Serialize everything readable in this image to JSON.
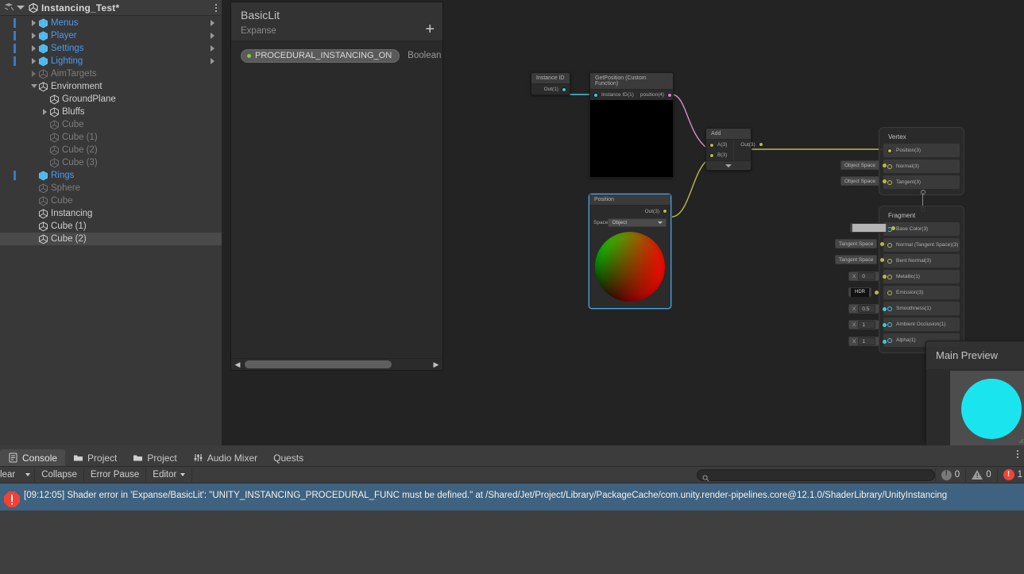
{
  "hierarchy": {
    "title": "Instancing_Test*",
    "icons": {
      "panel": "hierarchy-icon",
      "unity": "unity-logo-icon",
      "menu": "kebab-menu-icon"
    },
    "items": [
      {
        "label": "Menus",
        "indent": 1,
        "twisty": "closed",
        "style": "prefab",
        "chevron": true,
        "selbar": true
      },
      {
        "label": "Player",
        "indent": 1,
        "twisty": "closed",
        "style": "prefab",
        "chevron": true,
        "selbar": true
      },
      {
        "label": "Settings",
        "indent": 1,
        "twisty": "closed",
        "style": "prefab",
        "chevron": true,
        "selbar": true
      },
      {
        "label": "Lighting",
        "indent": 1,
        "twisty": "closed",
        "style": "prefab",
        "chevron": true,
        "selbar": true
      },
      {
        "label": "AimTargets",
        "indent": 1,
        "twisty": "closed-dim",
        "style": "dim",
        "chevron": false,
        "selbar": false
      },
      {
        "label": "Environment",
        "indent": 1,
        "twisty": "open",
        "style": "norm",
        "chevron": false,
        "selbar": false
      },
      {
        "label": "GroundPlane",
        "indent": 2,
        "twisty": "none",
        "style": "norm",
        "chevron": false,
        "selbar": false
      },
      {
        "label": "Bluffs",
        "indent": 2,
        "twisty": "closed",
        "style": "norm",
        "chevron": false,
        "selbar": false
      },
      {
        "label": "Cube",
        "indent": 2,
        "twisty": "none",
        "style": "dim",
        "chevron": false,
        "selbar": false
      },
      {
        "label": "Cube (1)",
        "indent": 2,
        "twisty": "none",
        "style": "dim",
        "chevron": false,
        "selbar": false
      },
      {
        "label": "Cube (2)",
        "indent": 2,
        "twisty": "none",
        "style": "dim",
        "chevron": false,
        "selbar": false
      },
      {
        "label": "Cube (3)",
        "indent": 2,
        "twisty": "none",
        "style": "dim",
        "chevron": false,
        "selbar": false
      },
      {
        "label": "Rings",
        "indent": 1,
        "twisty": "none",
        "style": "prefab",
        "chevron": false,
        "selbar": true
      },
      {
        "label": "Sphere",
        "indent": 1,
        "twisty": "none",
        "style": "dim",
        "chevron": false,
        "selbar": false
      },
      {
        "label": "Cube",
        "indent": 1,
        "twisty": "none",
        "style": "dim",
        "chevron": false,
        "selbar": false
      },
      {
        "label": "Instancing",
        "indent": 1,
        "twisty": "none",
        "style": "norm",
        "chevron": false,
        "selbar": false
      },
      {
        "label": "Cube (1)",
        "indent": 1,
        "twisty": "none",
        "style": "norm",
        "chevron": false,
        "selbar": false
      },
      {
        "label": "Cube (2)",
        "indent": 1,
        "twisty": "none",
        "style": "norm",
        "chevron": false,
        "selbar": false,
        "selected": true
      }
    ]
  },
  "blackboard": {
    "title": "BasicLit",
    "subtitle": "Expanse",
    "add_label": "+",
    "properties": [
      {
        "name": "PROCEDURAL_INSTANCING_ON",
        "type": "Boolean"
      }
    ]
  },
  "graph": {
    "nodes": {
      "instance_id": {
        "title": "Instance ID",
        "out_label": "Out(1)"
      },
      "get_position": {
        "title": "GetPosition (Custom Function)",
        "in_label": "Instance ID(1)",
        "out_label": "position(4)"
      },
      "add": {
        "title": "Add",
        "in_a": "A(3)",
        "in_b": "B(3)",
        "out": "Out(3)"
      },
      "position": {
        "title": "Position",
        "out_label": "Out(3)",
        "space_label": "Space",
        "space_value": "Object"
      }
    },
    "vertex_stack": {
      "title": "Vertex",
      "blocks": [
        {
          "label": "Position(3)",
          "control": null,
          "connected": true
        },
        {
          "label": "Normal(3)",
          "control": "Object Space",
          "connected": false
        },
        {
          "label": "Tangent(3)",
          "control": "Object Space",
          "connected": false
        }
      ]
    },
    "fragment_stack": {
      "title": "Fragment",
      "blocks": [
        {
          "label": "Base Color(3)",
          "control_type": "swatch",
          "value": ""
        },
        {
          "label": "Normal (Tangent Space)(3)",
          "control_type": "text",
          "value": "Tangent Space"
        },
        {
          "label": "Bent Normal(3)",
          "control_type": "text",
          "value": "Tangent Space"
        },
        {
          "label": "Metallic(1)",
          "control_type": "number",
          "value": "0"
        },
        {
          "label": "Emission(3)",
          "control_type": "hdr",
          "value": "HDR"
        },
        {
          "label": "Smoothness(1)",
          "control_type": "number",
          "value": "0.5"
        },
        {
          "label": "Ambient Occlusion(1)",
          "control_type": "number",
          "value": "1"
        },
        {
          "label": "Alpha(1)",
          "control_type": "number",
          "value": "1"
        }
      ]
    },
    "main_preview": {
      "title": "Main Preview",
      "sphere_color": "#1ae5ef"
    }
  },
  "console": {
    "tabs": [
      {
        "label": "Console",
        "icon": "console-icon",
        "active": true
      },
      {
        "label": "Project",
        "icon": "folder-icon",
        "active": false
      },
      {
        "label": "Project",
        "icon": "folder-icon",
        "active": false
      },
      {
        "label": "Audio Mixer",
        "icon": "audio-mixer-icon",
        "active": false
      },
      {
        "label": "Quests",
        "icon": null,
        "active": false
      }
    ],
    "toolbar": {
      "clear": "lear",
      "collapse": "Collapse",
      "error_pause": "Error Pause",
      "editor": "Editor",
      "search_placeholder": "",
      "counts": {
        "messages": "0",
        "warnings": "0",
        "errors": "1"
      }
    },
    "entries": [
      {
        "timestamp": "[09:12:05]",
        "text": "[09:12:05] Shader error in 'Expanse/BasicLit': \"UNITY_INSTANCING_PROCEDURAL_FUNC must be defined.\" at /Shared/Jet/Project/Library/PackageCache/com.unity.render-pipelines.core@12.1.0/ShaderLibrary/UnityInstancing",
        "severity": "error"
      }
    ]
  },
  "colors": {
    "accent_blue": "#4a9bf0",
    "port_vector1": "#4cc3d9",
    "port_vector3": "#b9b94b",
    "port_vector4": "#d188c7",
    "error_red": "#f0453a",
    "selection_blue": "#3a79c6"
  }
}
